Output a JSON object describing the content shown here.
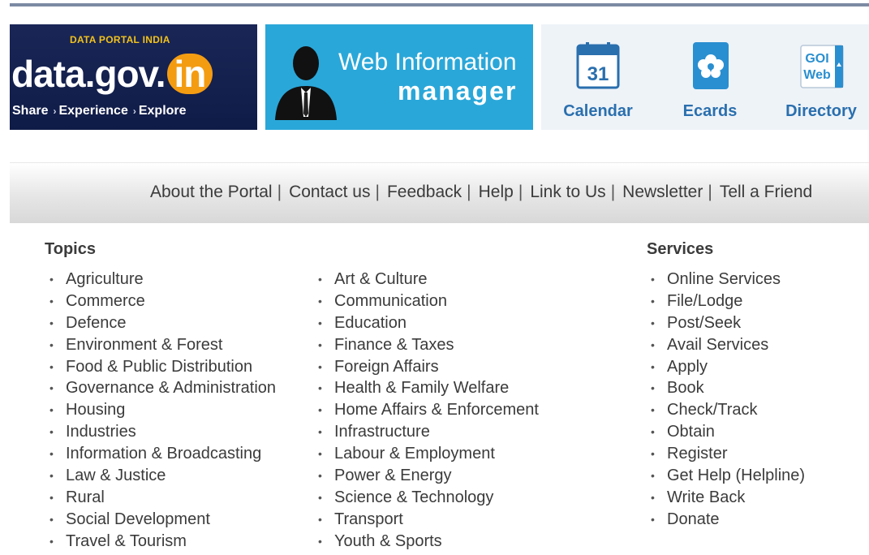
{
  "banner": {
    "portal_tag": "DATA PORTAL INDIA",
    "brand_main": "data.gov.",
    "brand_in": "in",
    "tagline": [
      "Share",
      "Experience",
      "Explore"
    ],
    "web_info_line1": "Web Information",
    "web_info_line2": "manager",
    "quick_links": [
      {
        "label": "Calendar",
        "icon": "calendar-icon",
        "icon_text": "31"
      },
      {
        "label": "Ecards",
        "icon": "ecard-icon"
      },
      {
        "label": "Directory",
        "icon": "goi-web-directory-icon",
        "icon_text_1": "GOI",
        "icon_text_2": "Web"
      }
    ]
  },
  "nav": {
    "links": [
      "About the Portal",
      "Contact us",
      "Feedback",
      "Help",
      "Link to Us",
      "Newsletter",
      "Tell a Friend"
    ]
  },
  "topics": {
    "title": "Topics",
    "col1": [
      "Agriculture",
      "Commerce",
      "Defence",
      "Environment & Forest",
      "Food & Public Distribution",
      "Governance & Administration",
      "Housing",
      "Industries",
      "Information & Broadcasting",
      "Law & Justice",
      "Rural",
      "Social Development",
      "Travel & Tourism"
    ],
    "col2": [
      "Art & Culture",
      "Communication",
      "Education",
      "Finance & Taxes",
      "Foreign Affairs",
      "Health & Family Welfare",
      "Home Affairs & Enforcement",
      "Infrastructure",
      "Labour & Employment",
      "Power & Energy",
      "Science & Technology",
      "Transport",
      "Youth & Sports"
    ]
  },
  "services": {
    "title": "Services",
    "items": [
      "Online Services",
      "File/Lodge",
      "Post/Seek",
      "Avail Services",
      "Apply",
      "Book",
      "Check/Track",
      "Obtain",
      "Register",
      "Get Help (Helpline)",
      "Write Back",
      "Donate"
    ]
  },
  "colors": {
    "brand_navy": "#0f1b47",
    "brand_orange": "#f39c12",
    "banner_blue": "#2aa7d9",
    "link_blue": "#2a6fae",
    "text_gray": "#3b3b3b"
  }
}
